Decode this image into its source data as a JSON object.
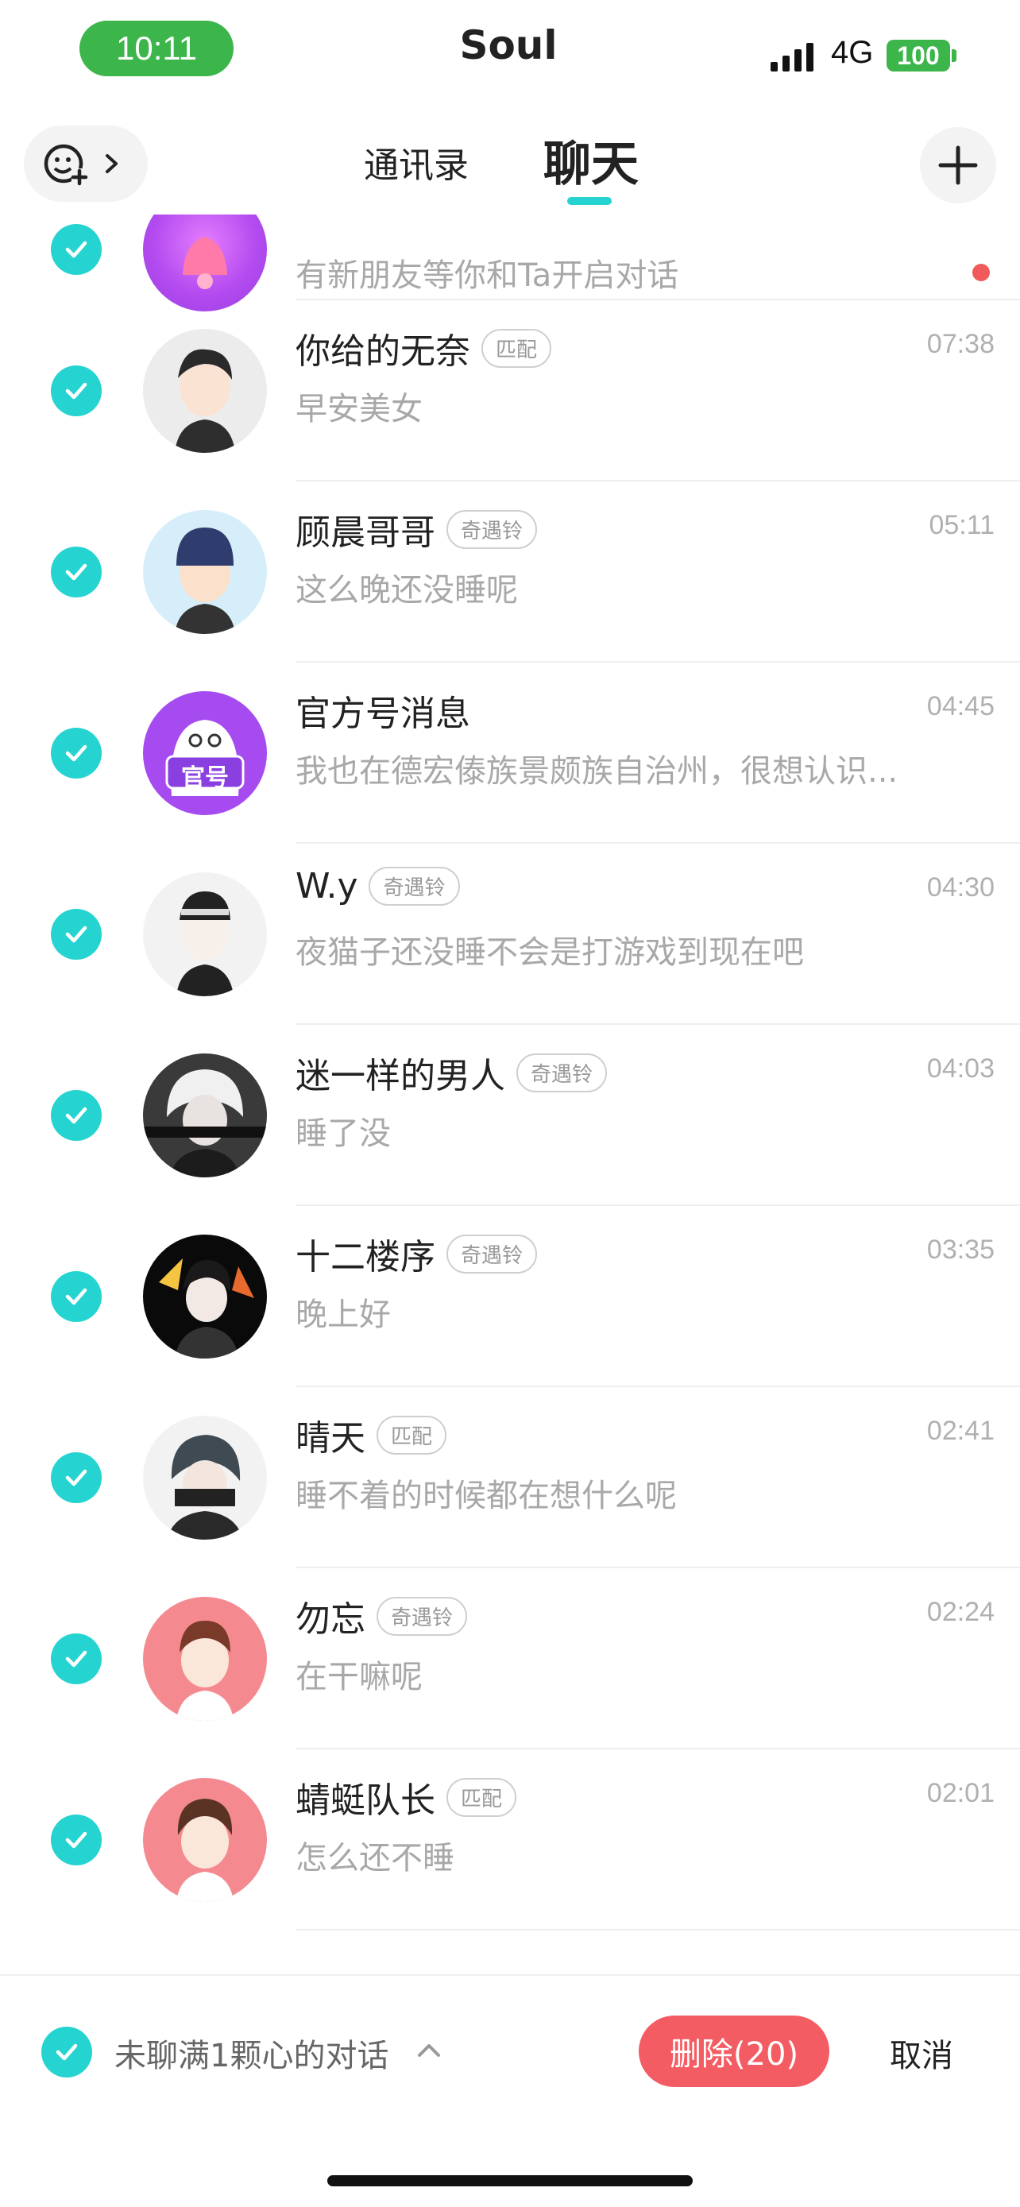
{
  "status_bar": {
    "time": "10:11",
    "app_name": "Soul",
    "network": "4G",
    "battery": "100"
  },
  "header": {
    "tabs": [
      {
        "label": "通讯录",
        "active": false
      },
      {
        "label": "聊天",
        "active": true
      }
    ]
  },
  "colors": {
    "accent": "#25d4d0",
    "delete": "#f45c63",
    "status_green": "#3cb54a",
    "unread_dot": "#f05a5a"
  },
  "chats": [
    {
      "name": "",
      "badge": "",
      "time": "",
      "message": "有新朋友等你和Ta开启对话",
      "checked": true,
      "unread": true,
      "avatar": "bell-avatar"
    },
    {
      "name": "你给的无奈",
      "badge": "匹配",
      "time": "07:38",
      "message": "早安美女",
      "checked": true,
      "avatar": "user-avatar"
    },
    {
      "name": "顾晨哥哥",
      "badge": "奇遇铃",
      "time": "05:11",
      "message": "这么晚还没睡呢",
      "checked": true,
      "avatar": "user-avatar"
    },
    {
      "name": "官方号消息",
      "badge": "",
      "time": "04:45",
      "message": "我也在德宏傣族景颇族自治州，很想认识...",
      "checked": true,
      "avatar": "official-avatar",
      "avatar_label": "官号"
    },
    {
      "name": "W.y",
      "badge": "奇遇铃",
      "time": "04:30",
      "message": "夜猫子还没睡不会是打游戏到现在吧",
      "checked": true,
      "avatar": "user-avatar"
    },
    {
      "name": "迷一样的男人",
      "badge": "奇遇铃",
      "time": "04:03",
      "message": "睡了没",
      "checked": true,
      "avatar": "user-avatar"
    },
    {
      "name": "十二楼序",
      "badge": "奇遇铃",
      "time": "03:35",
      "message": "晚上好",
      "checked": true,
      "avatar": "user-avatar"
    },
    {
      "name": "晴天",
      "badge": "匹配",
      "time": "02:41",
      "message": "睡不着的时候都在想什么呢",
      "checked": true,
      "avatar": "user-avatar"
    },
    {
      "name": "勿忘",
      "badge": "奇遇铃",
      "time": "02:24",
      "message": "在干嘛呢",
      "checked": true,
      "avatar": "user-avatar"
    },
    {
      "name": "蜻蜓队长",
      "badge": "匹配",
      "time": "02:01",
      "message": "怎么还不睡",
      "checked": true,
      "avatar": "user-avatar"
    }
  ],
  "bottom_bar": {
    "filter_label": "未聊满1颗心的对话",
    "delete_label": "删除(20)",
    "cancel_label": "取消"
  }
}
